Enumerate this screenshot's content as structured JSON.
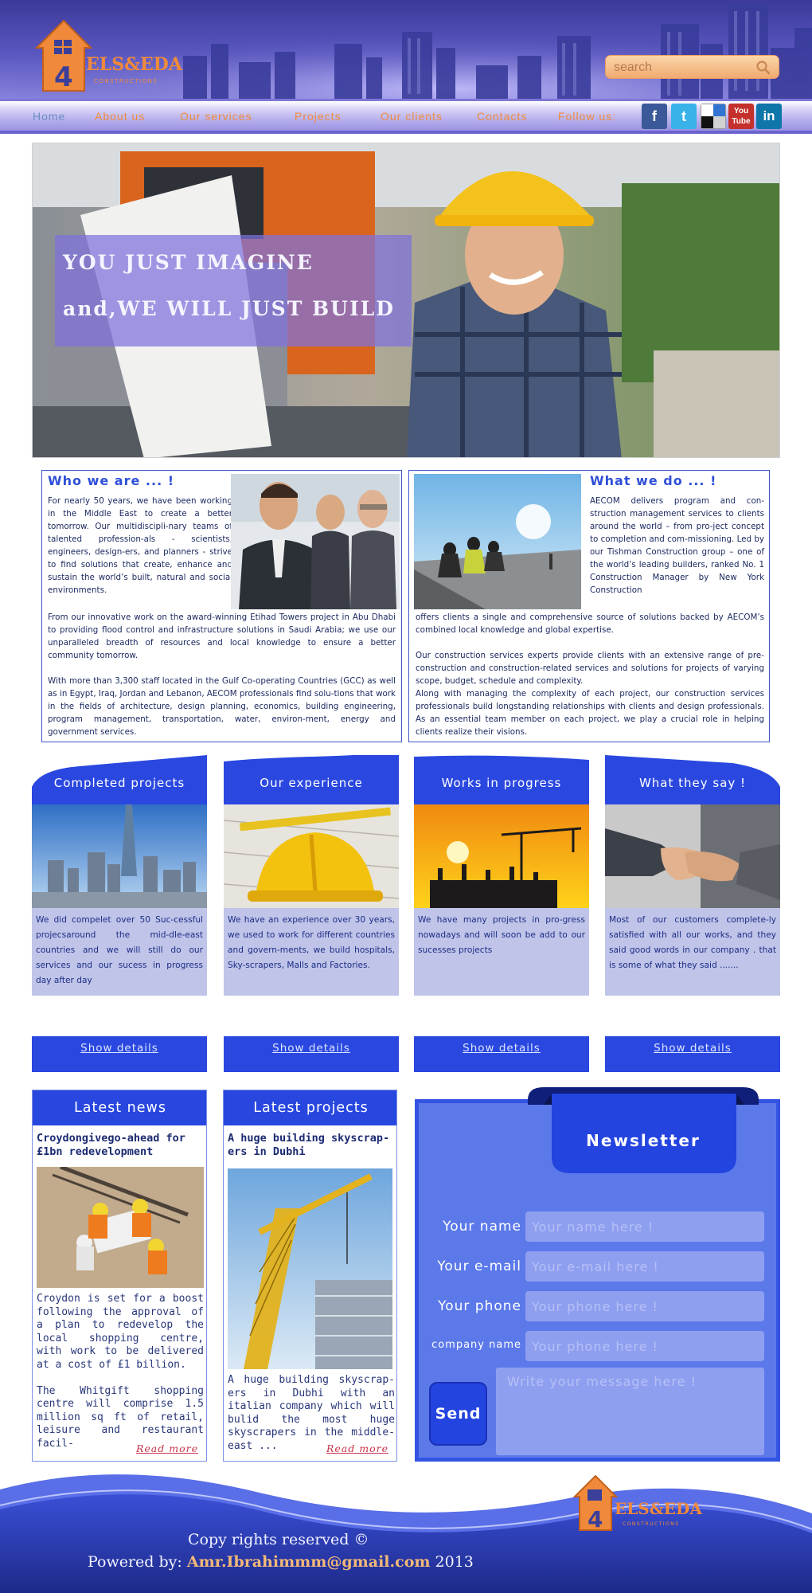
{
  "brand": {
    "logo_number": "4",
    "logo_text": "ELS&EDA",
    "logo_sub": "CONSTRUCTIONS"
  },
  "search": {
    "placeholder": "search"
  },
  "nav": {
    "items": [
      {
        "label": "Home"
      },
      {
        "label": "About us"
      },
      {
        "label": "Our services"
      },
      {
        "label": "Projects"
      },
      {
        "label": "Our clients"
      },
      {
        "label": "Contacts"
      }
    ],
    "follow_label": "Follow us:",
    "social": [
      "facebook-icon",
      "twitter-icon",
      "delicious-icon",
      "youtube-icon",
      "linkedin-icon"
    ],
    "youtube_label_1": "You",
    "youtube_label_2": "Tube",
    "linkedin_label": "in"
  },
  "hero": {
    "line1": "YOU JUST IMAGINE",
    "line2": "and,WE WILL JUST BUILD"
  },
  "who": {
    "title": "Who we are ... !",
    "intro": "For nearly 50 years, we have been working in the Middle East to create a better tomorrow. Our multidiscipli-nary teams of talented profession-als - scientists, engineers, design-ers, and planners - strive to find solutions that create, enhance and sustain the world’s built, natural and social environments.",
    "body": "From our innovative work on the award-winning Etihad Towers project in Abu Dhabi to providing flood control and infrastructure solutions in Saudi Arabia; we use our unparalleled breadth of resources and local knowledge to ensure a better community tomorrow.\n\nWith more than 3,300 staff located in the Gulf Co-operating Countries (GCC) as well as in Egypt, Iraq, Jordan and Lebanon, AECOM professionals find solu-tions that work in the fields of architecture, design planning, economics, building engineering, program management, transportation, water, environ-ment, energy and government services."
  },
  "what": {
    "title": "What we do ... !",
    "intro": "AECOM delivers program and con-struction management services to clients around the world – from pro-ject concept to completion and com-missioning.  Led by our Tishman Construction group – one of the world’s leading builders, ranked No. 1 Construction Manager by New York Construction",
    "body": "offers clients a single and comprehensive source of solutions backed by AECOM’s combined local knowledge and global expertise.\n\nOur construction services experts provide clients with an extensive range of pre-construction and construction-related services and solutions for projects of varying scope, budget, schedule and complexity.\nAlong with managing the complexity of each project, our construction services professionals build longstanding relationships with clients and design professionals.  As an essential team member on each project, we play a crucial role in helping clients realize their visions."
  },
  "cards": [
    {
      "title": "Completed projects",
      "text": "We did compelet over 50 Suc-cessful projecsaround the mid-dle-east countries and we will still do our services and our sucess in progress day after day",
      "button": "Show details"
    },
    {
      "title": "Our experience",
      "text": "We have an experience over 30 years, we used to work for different countries and govern-ments, we build hospitals, Sky-scrapers, Malls and Factories.",
      "button": "Show details"
    },
    {
      "title": "Works in progress",
      "text": "We have many projects in pro-gress nowadays and will soon be add to our sucesses projects",
      "button": "Show details"
    },
    {
      "title": "What they say !",
      "text": "Most of our customers complete-ly satisfied with all our works, and they said good words in our company . that is some of what they said .......",
      "button": "Show details"
    }
  ],
  "news": {
    "heading": "Latest news",
    "title": "Croydongivego-ahead for £1bn redevelopment",
    "text": "Croydon is set for a boost following the approval of a plan to redevelop the local shopping centre, with work to be delivered at a cost of £1 billion.\n\nThe Whitgift shopping centre will comprise 1.5 million sq ft of retail, leisure and restaurant facil-",
    "read_more": "Read more"
  },
  "projects": {
    "heading": "Latest projects",
    "title": "A huge building skyscrap-ers in Dubhi",
    "text": "A huge building skyscrap-ers in Dubhi with an italian company which will bulid the most huge skyscrapers in the middle-east ...",
    "read_more": "Read more"
  },
  "newsletter": {
    "title": "Newsletter",
    "fields": [
      {
        "label": "Your name",
        "placeholder": "Your name here !"
      },
      {
        "label": "Your e-mail",
        "placeholder": "Your e-mail here !"
      },
      {
        "label": "Your phone",
        "placeholder": "Your phone here !"
      },
      {
        "label": "company name",
        "placeholder": "Your phone here !"
      }
    ],
    "message_placeholder": "Write your message here !",
    "send": "Send"
  },
  "footer": {
    "copyright": "Copy rights reserved ©",
    "powered_prefix": "Powered by: ",
    "email": "Amr.Ibrahimmm@gmail.com",
    "year": " 2013"
  },
  "colors": {
    "brand_orange": "#ef8b3c",
    "brand_blue": "#2a48e0",
    "nav_purple": "#7f77d6"
  }
}
